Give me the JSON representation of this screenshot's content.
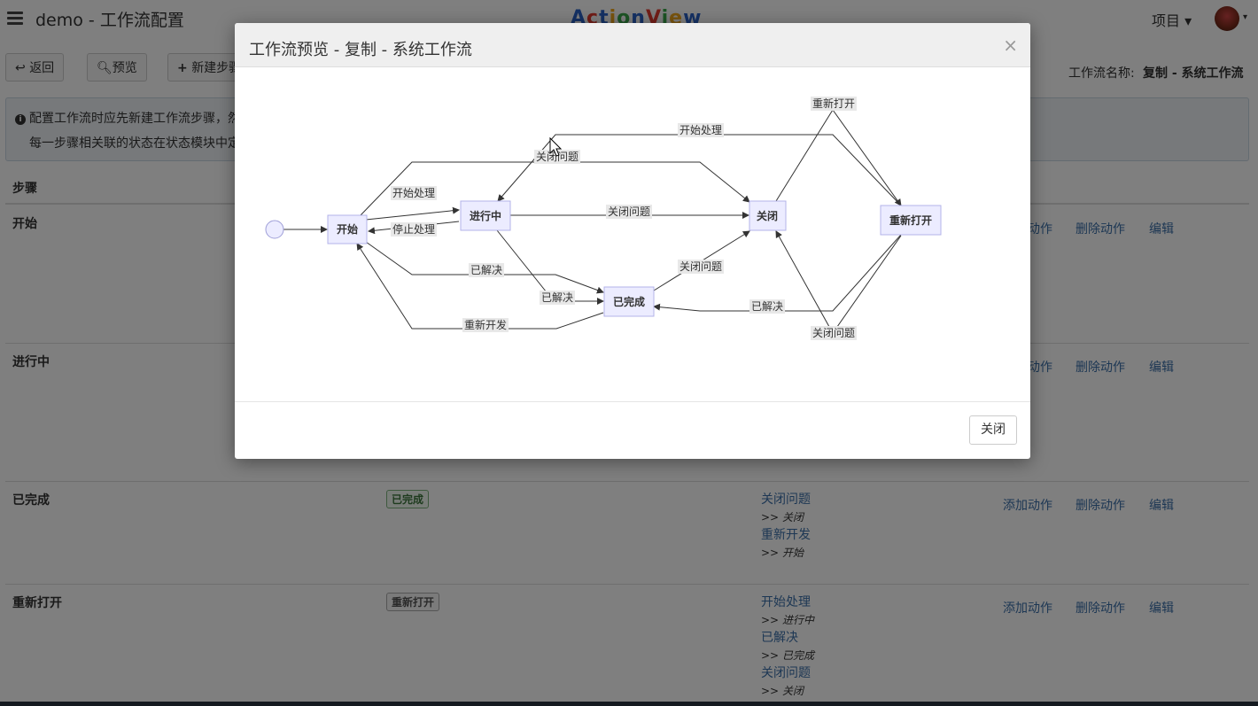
{
  "topbar": {
    "title": "demo - 工作流配置",
    "logo": "ActionView",
    "project_menu": "项目 ▾",
    "avatar_caret": "▾"
  },
  "toolbar": {
    "back": "返回",
    "preview": "预览",
    "new_step": "新建步骤",
    "workflow_name_label": "工作流名称:",
    "workflow_name_value": "复制 - 系统工作流"
  },
  "info": {
    "line1": "配置工作流时应先新建工作流步骤，然",
    "line2": "每一步骤相关联的状态在状态模块中定"
  },
  "table": {
    "step_header": "步骤",
    "rows": [
      {
        "name": "开始",
        "actions": [],
        "ops": [
          "添加动作",
          "删除动作",
          "编辑"
        ]
      },
      {
        "name": "进行中",
        "actions": [],
        "ops": [
          "添加动作",
          "删除动作",
          "编辑"
        ]
      },
      {
        "name": "已完成",
        "state": "已完成",
        "actions": [
          {
            "label": "关闭问题",
            "target": ">> 关闭"
          },
          {
            "label": "重新开发",
            "target": ">> 开始"
          }
        ],
        "ops": [
          "添加动作",
          "删除动作",
          "编辑"
        ]
      },
      {
        "name": "重新打开",
        "state": "重新打开",
        "actions": [
          {
            "label": "开始处理",
            "target": ">> 进行中"
          },
          {
            "label": "已解决",
            "target": ">> 已完成"
          },
          {
            "label": "关闭问题",
            "target": ">> 关闭"
          }
        ],
        "ops": [
          "添加动作",
          "删除动作",
          "编辑"
        ]
      }
    ]
  },
  "modal": {
    "title": "工作流预览 - 复制 - 系统工作流",
    "close_x": "×",
    "close_button": "关闭"
  },
  "diagram": {
    "nodes": [
      "开始",
      "进行中",
      "已完成",
      "关闭",
      "重新打开"
    ],
    "edge_labels": {
      "start_progress": "开始处理",
      "stop_progress": "停止处理",
      "start_resolved": "已解决",
      "top_close": "关闭问题",
      "progress_close": "关闭问题",
      "progress_resolved": "已解决",
      "done_close": "关闭问题",
      "done_redevelop": "重新开发",
      "close_reopen": "重新打开",
      "reopen_start_progress": "开始处理",
      "reopen_resolved": "已解决",
      "reopen_close": "关闭问题"
    }
  }
}
